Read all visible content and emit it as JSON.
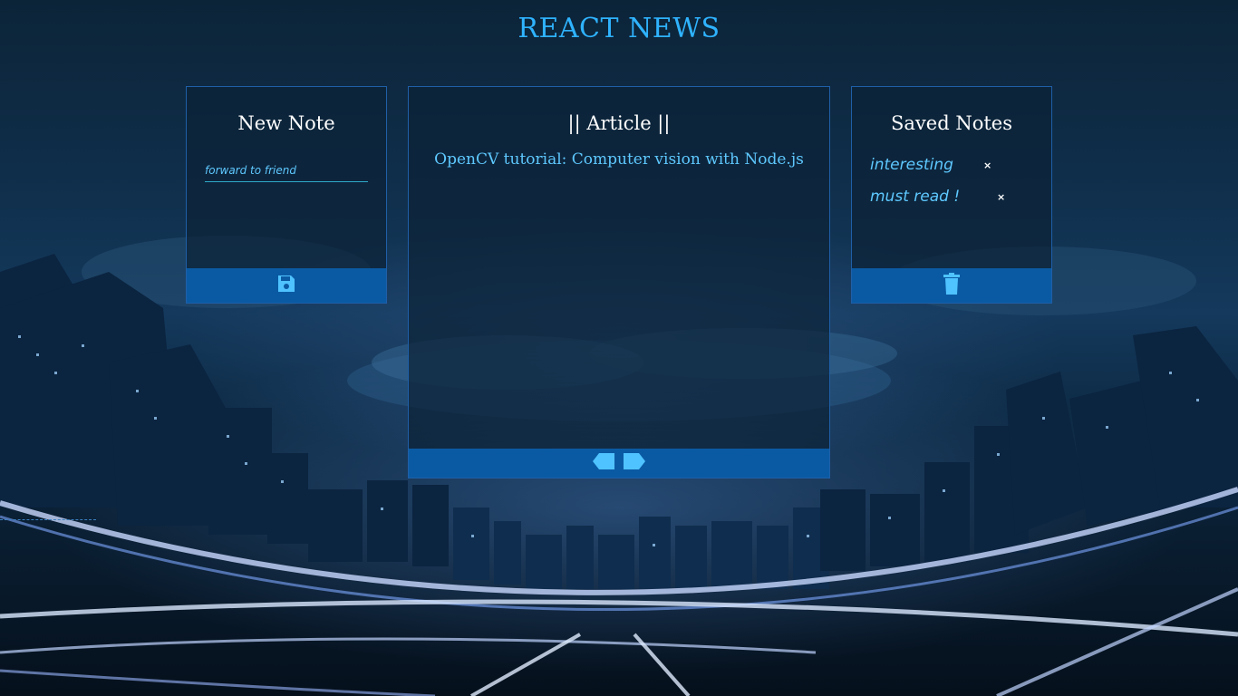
{
  "app": {
    "title": "REACT NEWS"
  },
  "new_note": {
    "title": "New Note",
    "input_value": "forward to friend",
    "save_icon": "save-icon"
  },
  "article": {
    "title": "|| Article ||",
    "headline": "OpenCV tutorial: Computer vision with Node.js",
    "prev_icon": "arrow-left-icon",
    "next_icon": "arrow-right-icon"
  },
  "saved_notes": {
    "title": "Saved Notes",
    "items": [
      {
        "text": "interesting",
        "remove": "×"
      },
      {
        "text": "must read !",
        "remove": "×"
      }
    ],
    "delete_icon": "trash-icon"
  },
  "colors": {
    "accent": "#2fb3ff",
    "footer": "#0a5aa3",
    "panel_border": "#1f5fa8"
  }
}
